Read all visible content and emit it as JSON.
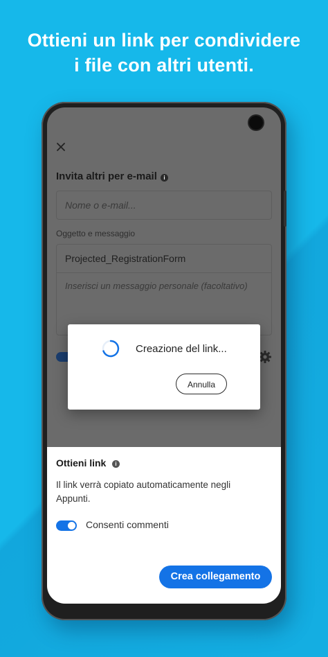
{
  "headline": {
    "line1": "Ottieni un link per condividere",
    "line2": "i file con altri utenti."
  },
  "invite": {
    "title": "Invita altri per e-mail",
    "name_placeholder": "Nome o e-mail...",
    "subject_label": "Oggetto e messaggio",
    "subject_value": "Projected_RegistrationForm",
    "message_placeholder": "Inserisci un messaggio personale (facoltativo)"
  },
  "dialog": {
    "text": "Creazione del link...",
    "cancel_label": "Annulla"
  },
  "sheet": {
    "title": "Ottieni link",
    "description": "Il link verrà copiato automaticamente negli Appunti.",
    "toggle_label": "Consenti commenti",
    "toggle_on": true,
    "create_label": "Crea collegamento"
  },
  "colors": {
    "background": "#16b8ea",
    "accent": "#1473e6"
  },
  "icons": [
    "close-icon",
    "info-icon",
    "gear-icon",
    "spinner-icon"
  ]
}
